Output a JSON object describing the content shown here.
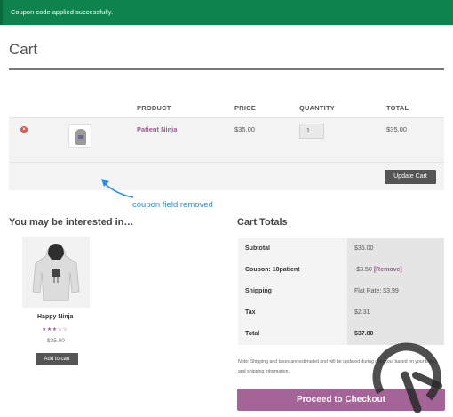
{
  "notice": {
    "text": "Coupon code applied successfully."
  },
  "page": {
    "title": "Cart"
  },
  "cart_table": {
    "headers": {
      "product": "PRODUCT",
      "price": "PRICE",
      "quantity": "QUANTITY",
      "total": "TOTAL"
    },
    "rows": [
      {
        "product": "Patient Ninja",
        "price": "$35.00",
        "quantity": "1",
        "total": "$35.00"
      }
    ],
    "update_button": "Update Cart"
  },
  "annotation": {
    "text": "coupon field removed",
    "color": "#2b8ee6"
  },
  "cross_sells": {
    "title": "You may be interested in…",
    "products": [
      {
        "name": "Happy Ninja",
        "price": "$35.00",
        "rating": 3,
        "button": "Add to cart"
      }
    ]
  },
  "cart_totals": {
    "title": "Cart Totals",
    "rows": [
      {
        "label": "Subtotal",
        "value": "$35.00"
      },
      {
        "label": "Coupon: 10patient",
        "value": "-$3.50",
        "link": "[Remove]"
      },
      {
        "label": "Shipping",
        "value": "Flat Rate: $3.99"
      },
      {
        "label": "Tax",
        "value": "$2.31"
      },
      {
        "label": "Total",
        "value": "$37.80"
      }
    ],
    "note": "Note: Shipping and taxes are estimated and will be updated during checkout based on your billing and shipping information.",
    "checkout_button": "Proceed to Checkout"
  },
  "colors": {
    "notice_bg": "#0f834d",
    "accent": "#9b5c8f",
    "checkout": "#a46497",
    "dark_button": "#555555"
  }
}
